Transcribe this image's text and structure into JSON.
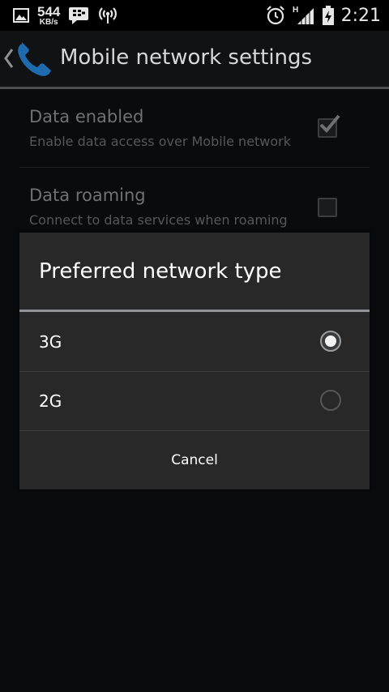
{
  "status_bar": {
    "net_speed_value": "544",
    "net_speed_unit": "KB/s",
    "network_type_badge": "H",
    "time": "2:21",
    "icons": [
      "image-icon",
      "bbm-icon",
      "hotspot-icon",
      "alarm-icon",
      "signal-icon",
      "battery-icon"
    ]
  },
  "action_bar": {
    "title": "Mobile network settings",
    "app_icon": "phone-icon",
    "accent_color": "#1e6bb0"
  },
  "settings": {
    "items": [
      {
        "title": "Data enabled",
        "summary": "Enable data access over Mobile network",
        "checked": true
      },
      {
        "title": "Data roaming",
        "summary": "Connect to data services when roaming",
        "checked": false
      }
    ]
  },
  "dialog": {
    "title": "Preferred network type",
    "options": [
      {
        "label": "3G",
        "selected": true
      },
      {
        "label": "2G",
        "selected": false
      }
    ],
    "cancel_label": "Cancel"
  }
}
